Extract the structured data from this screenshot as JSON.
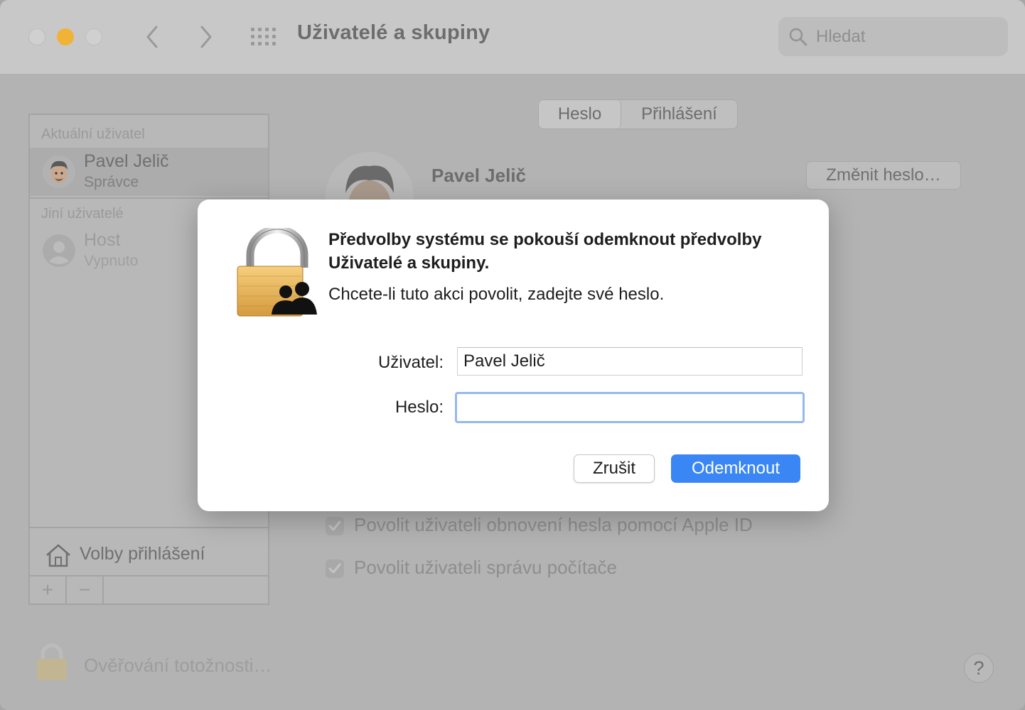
{
  "window": {
    "title": "Uživatelé a skupiny",
    "search_placeholder": "Hledat"
  },
  "sidebar": {
    "current_section": "Aktuální uživatel",
    "current_user": {
      "name": "Pavel Jelič",
      "role": "Správce"
    },
    "other_section": "Jiní uživatelé",
    "other_users": [
      {
        "name": "Host",
        "status": "Vypnuto"
      }
    ],
    "login_options": "Volby přihlášení",
    "add_label": "+",
    "remove_label": "−"
  },
  "main": {
    "tabs": [
      {
        "label": "Heslo"
      },
      {
        "label": "Přihlášení"
      }
    ],
    "user_name": "Pavel Jelič",
    "change_password": "Změnit heslo…",
    "options": [
      {
        "label": "Povolit uživateli obnovení hesla pomocí Apple ID",
        "checked": true
      },
      {
        "label": "Povolit uživateli správu počítače",
        "checked": true
      }
    ]
  },
  "footer": {
    "auth_label": "Ověřování totožnosti…",
    "help_label": "?"
  },
  "dialog": {
    "title": "Předvolby systému se pokouší odemknout předvolby Uživatelé a skupiny.",
    "subtitle": "Chcete-li tuto akci povolit, zadejte své heslo.",
    "user_label": "Uživatel:",
    "user_value": "Pavel Jelič",
    "password_label": "Heslo:",
    "password_value": "",
    "cancel": "Zrušit",
    "unlock": "Odemknout"
  },
  "colors": {
    "accent": "#3b86f5",
    "focus_ring": "#97b8ef",
    "minimize": "#f0b338"
  }
}
